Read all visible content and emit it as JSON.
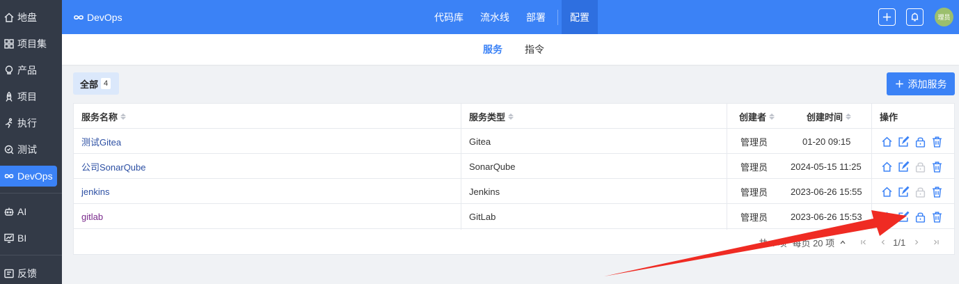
{
  "sidebar": {
    "items": [
      {
        "label": "地盘",
        "icon": "home-icon"
      },
      {
        "label": "项目集",
        "icon": "grid-icon"
      },
      {
        "label": "产品",
        "icon": "bulb-icon"
      },
      {
        "label": "项目",
        "icon": "rocket-icon"
      },
      {
        "label": "执行",
        "icon": "run-icon"
      },
      {
        "label": "测试",
        "icon": "test-icon"
      },
      {
        "label": "DevOps",
        "icon": "infinity-icon"
      },
      {
        "label": "AI",
        "icon": "robot-icon"
      },
      {
        "label": "BI",
        "icon": "chart-icon"
      },
      {
        "label": "反馈",
        "icon": "feedback-icon"
      }
    ]
  },
  "header": {
    "brand": "DevOps",
    "nav": [
      "代码库",
      "流水线",
      "部署",
      "配置"
    ],
    "avatar": "理员",
    "colors": {
      "primary": "#3b82f6",
      "sidebar": "#333a47",
      "active_nav": "#2e6fe0"
    }
  },
  "subtabs": [
    "服务",
    "指令"
  ],
  "filter": {
    "label": "全部",
    "count": "4"
  },
  "add_button": "添加服务",
  "table": {
    "columns": [
      "服务名称",
      "服务类型",
      "创建者",
      "创建时间",
      "操作"
    ],
    "rows": [
      {
        "name": "测试Gitea",
        "type": "Gitea",
        "creator": "管理员",
        "time": "01-20 09:15"
      },
      {
        "name": "公司SonarQube",
        "type": "SonarQube",
        "creator": "管理员",
        "time": "2024-05-15 11:25"
      },
      {
        "name": "jenkins",
        "type": "Jenkins",
        "creator": "管理员",
        "time": "2023-06-26 15:55"
      },
      {
        "name": "gitlab",
        "type": "GitLab",
        "creator": "管理员",
        "time": "2023-06-26 15:53"
      }
    ]
  },
  "pagination": {
    "total": "共 4 项",
    "per_page": "每页 20 项",
    "page": "1/1"
  }
}
